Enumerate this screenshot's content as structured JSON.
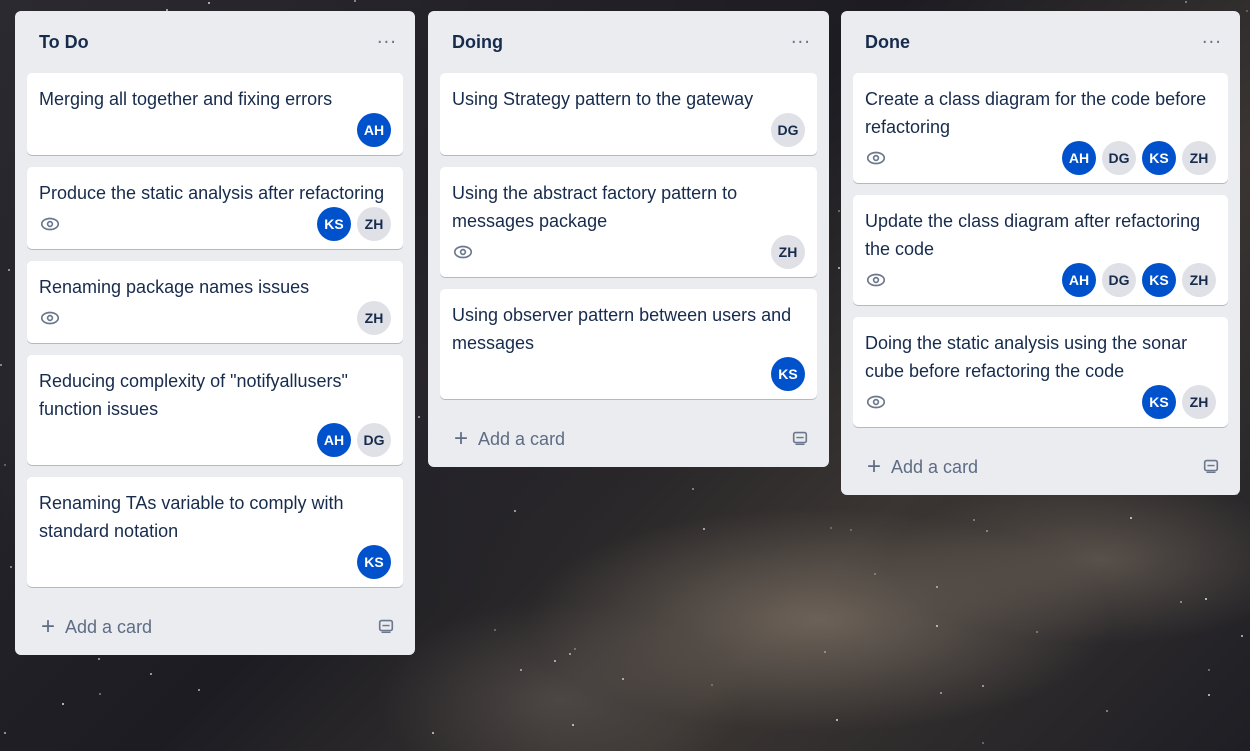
{
  "lists": [
    {
      "title": "To Do",
      "menu": "···",
      "add_card_label": "Add a card",
      "cards": [
        {
          "title": "Merging all together and fixing errors",
          "watch": false,
          "members": [
            {
              "initials": "AH",
              "style": "blue"
            }
          ]
        },
        {
          "title": "Produce the static analysis after refactoring",
          "watch": true,
          "members": [
            {
              "initials": "KS",
              "style": "blue"
            },
            {
              "initials": "ZH",
              "style": "gray"
            }
          ]
        },
        {
          "title": "Renaming package names issues",
          "watch": true,
          "members": [
            {
              "initials": "ZH",
              "style": "gray"
            }
          ]
        },
        {
          "title": "Reducing complexity of \"notifyallusers\" function issues",
          "watch": false,
          "members": [
            {
              "initials": "AH",
              "style": "blue"
            },
            {
              "initials": "DG",
              "style": "gray"
            }
          ]
        },
        {
          "title": "Renaming TAs variable to comply with standard notation",
          "watch": false,
          "members": [
            {
              "initials": "KS",
              "style": "blue"
            }
          ]
        }
      ]
    },
    {
      "title": "Doing",
      "menu": "···",
      "add_card_label": "Add a card",
      "cards": [
        {
          "title": "Using Strategy pattern to the gateway",
          "watch": false,
          "members": [
            {
              "initials": "DG",
              "style": "gray"
            }
          ]
        },
        {
          "title": "Using the abstract factory pattern to messages package",
          "watch": true,
          "members": [
            {
              "initials": "ZH",
              "style": "gray"
            }
          ]
        },
        {
          "title": "Using observer pattern between users and messages",
          "watch": false,
          "members": [
            {
              "initials": "KS",
              "style": "blue"
            }
          ]
        }
      ]
    },
    {
      "title": "Done",
      "menu": "···",
      "add_card_label": "Add a card",
      "cards": [
        {
          "title": "Create a class diagram for the code before refactoring",
          "watch": true,
          "members": [
            {
              "initials": "AH",
              "style": "blue"
            },
            {
              "initials": "DG",
              "style": "gray"
            },
            {
              "initials": "KS",
              "style": "blue"
            },
            {
              "initials": "ZH",
              "style": "gray"
            }
          ]
        },
        {
          "title": "Update the class diagram after refactoring the code",
          "watch": true,
          "members": [
            {
              "initials": "AH",
              "style": "blue"
            },
            {
              "initials": "DG",
              "style": "gray"
            },
            {
              "initials": "KS",
              "style": "blue"
            },
            {
              "initials": "ZH",
              "style": "gray"
            }
          ]
        },
        {
          "title": "Doing the static analysis using the sonar cube before refactoring the code",
          "watch": true,
          "members": [
            {
              "initials": "KS",
              "style": "blue"
            },
            {
              "initials": "ZH",
              "style": "gray"
            }
          ]
        }
      ]
    }
  ],
  "icons": {
    "watch": "eye-icon",
    "add": "plus-icon",
    "template": "card-template-icon",
    "menu": "ellipsis-icon"
  },
  "colors": {
    "list_bg": "#ebecf0",
    "avatar_blue": "#0052cc",
    "avatar_gray": "#dfe1e6",
    "text": "#172b4d"
  }
}
